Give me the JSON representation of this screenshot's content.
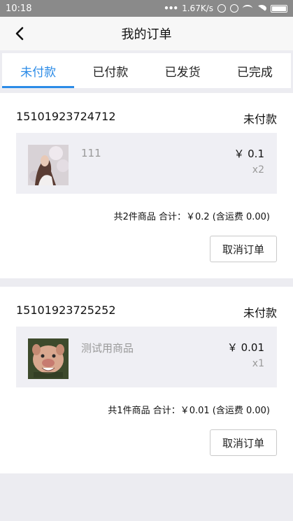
{
  "status_bar": {
    "time": "10:18",
    "net_speed": "1.67K/s",
    "icons": [
      "mute-icon",
      "alarm-icon",
      "wifi-icon",
      "signal-icon",
      "battery-icon"
    ]
  },
  "header": {
    "title": "我的订单",
    "back_icon": "chevron-left-icon"
  },
  "tabs": [
    {
      "label": "未付款",
      "active": true
    },
    {
      "label": "已付款",
      "active": false
    },
    {
      "label": "已发货",
      "active": false
    },
    {
      "label": "已完成",
      "active": false
    }
  ],
  "colors": {
    "accent": "#2b8be7",
    "background": "#ececf1",
    "goods_background": "#efeff4"
  },
  "orders": [
    {
      "order_no": "15101923724712",
      "status": "未付款",
      "item": {
        "name": "111",
        "price": "￥ 0.1",
        "qty": "x2"
      },
      "summary": "共2件商品   合计：￥0.2  (含运费 0.00)",
      "cancel_label": "取消订单"
    },
    {
      "order_no": "15101923725252",
      "status": "未付款",
      "item": {
        "name": "测试用商品",
        "price": "￥ 0.01",
        "qty": "x1"
      },
      "summary": "共1件商品   合计：￥0.01  (含运费 0.00)",
      "cancel_label": "取消订单"
    }
  ]
}
